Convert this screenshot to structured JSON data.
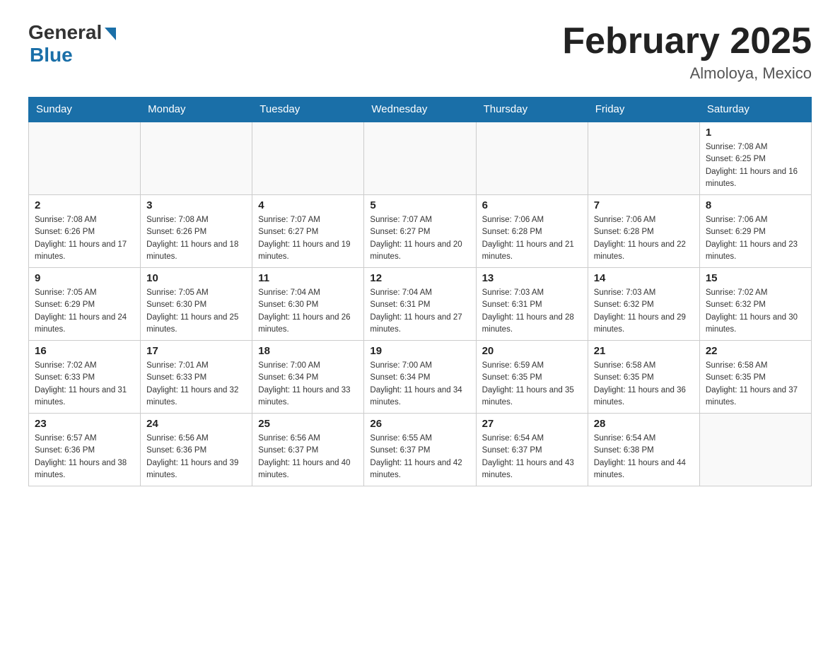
{
  "header": {
    "logo": {
      "general": "General",
      "blue": "Blue"
    },
    "title": "February 2025",
    "location": "Almoloya, Mexico"
  },
  "days_of_week": [
    "Sunday",
    "Monday",
    "Tuesday",
    "Wednesday",
    "Thursday",
    "Friday",
    "Saturday"
  ],
  "weeks": [
    [
      {
        "day": "",
        "info": ""
      },
      {
        "day": "",
        "info": ""
      },
      {
        "day": "",
        "info": ""
      },
      {
        "day": "",
        "info": ""
      },
      {
        "day": "",
        "info": ""
      },
      {
        "day": "",
        "info": ""
      },
      {
        "day": "1",
        "info": "Sunrise: 7:08 AM\nSunset: 6:25 PM\nDaylight: 11 hours and 16 minutes."
      }
    ],
    [
      {
        "day": "2",
        "info": "Sunrise: 7:08 AM\nSunset: 6:26 PM\nDaylight: 11 hours and 17 minutes."
      },
      {
        "day": "3",
        "info": "Sunrise: 7:08 AM\nSunset: 6:26 PM\nDaylight: 11 hours and 18 minutes."
      },
      {
        "day": "4",
        "info": "Sunrise: 7:07 AM\nSunset: 6:27 PM\nDaylight: 11 hours and 19 minutes."
      },
      {
        "day": "5",
        "info": "Sunrise: 7:07 AM\nSunset: 6:27 PM\nDaylight: 11 hours and 20 minutes."
      },
      {
        "day": "6",
        "info": "Sunrise: 7:06 AM\nSunset: 6:28 PM\nDaylight: 11 hours and 21 minutes."
      },
      {
        "day": "7",
        "info": "Sunrise: 7:06 AM\nSunset: 6:28 PM\nDaylight: 11 hours and 22 minutes."
      },
      {
        "day": "8",
        "info": "Sunrise: 7:06 AM\nSunset: 6:29 PM\nDaylight: 11 hours and 23 minutes."
      }
    ],
    [
      {
        "day": "9",
        "info": "Sunrise: 7:05 AM\nSunset: 6:29 PM\nDaylight: 11 hours and 24 minutes."
      },
      {
        "day": "10",
        "info": "Sunrise: 7:05 AM\nSunset: 6:30 PM\nDaylight: 11 hours and 25 minutes."
      },
      {
        "day": "11",
        "info": "Sunrise: 7:04 AM\nSunset: 6:30 PM\nDaylight: 11 hours and 26 minutes."
      },
      {
        "day": "12",
        "info": "Sunrise: 7:04 AM\nSunset: 6:31 PM\nDaylight: 11 hours and 27 minutes."
      },
      {
        "day": "13",
        "info": "Sunrise: 7:03 AM\nSunset: 6:31 PM\nDaylight: 11 hours and 28 minutes."
      },
      {
        "day": "14",
        "info": "Sunrise: 7:03 AM\nSunset: 6:32 PM\nDaylight: 11 hours and 29 minutes."
      },
      {
        "day": "15",
        "info": "Sunrise: 7:02 AM\nSunset: 6:32 PM\nDaylight: 11 hours and 30 minutes."
      }
    ],
    [
      {
        "day": "16",
        "info": "Sunrise: 7:02 AM\nSunset: 6:33 PM\nDaylight: 11 hours and 31 minutes."
      },
      {
        "day": "17",
        "info": "Sunrise: 7:01 AM\nSunset: 6:33 PM\nDaylight: 11 hours and 32 minutes."
      },
      {
        "day": "18",
        "info": "Sunrise: 7:00 AM\nSunset: 6:34 PM\nDaylight: 11 hours and 33 minutes."
      },
      {
        "day": "19",
        "info": "Sunrise: 7:00 AM\nSunset: 6:34 PM\nDaylight: 11 hours and 34 minutes."
      },
      {
        "day": "20",
        "info": "Sunrise: 6:59 AM\nSunset: 6:35 PM\nDaylight: 11 hours and 35 minutes."
      },
      {
        "day": "21",
        "info": "Sunrise: 6:58 AM\nSunset: 6:35 PM\nDaylight: 11 hours and 36 minutes."
      },
      {
        "day": "22",
        "info": "Sunrise: 6:58 AM\nSunset: 6:35 PM\nDaylight: 11 hours and 37 minutes."
      }
    ],
    [
      {
        "day": "23",
        "info": "Sunrise: 6:57 AM\nSunset: 6:36 PM\nDaylight: 11 hours and 38 minutes."
      },
      {
        "day": "24",
        "info": "Sunrise: 6:56 AM\nSunset: 6:36 PM\nDaylight: 11 hours and 39 minutes."
      },
      {
        "day": "25",
        "info": "Sunrise: 6:56 AM\nSunset: 6:37 PM\nDaylight: 11 hours and 40 minutes."
      },
      {
        "day": "26",
        "info": "Sunrise: 6:55 AM\nSunset: 6:37 PM\nDaylight: 11 hours and 42 minutes."
      },
      {
        "day": "27",
        "info": "Sunrise: 6:54 AM\nSunset: 6:37 PM\nDaylight: 11 hours and 43 minutes."
      },
      {
        "day": "28",
        "info": "Sunrise: 6:54 AM\nSunset: 6:38 PM\nDaylight: 11 hours and 44 minutes."
      },
      {
        "day": "",
        "info": ""
      }
    ]
  ]
}
